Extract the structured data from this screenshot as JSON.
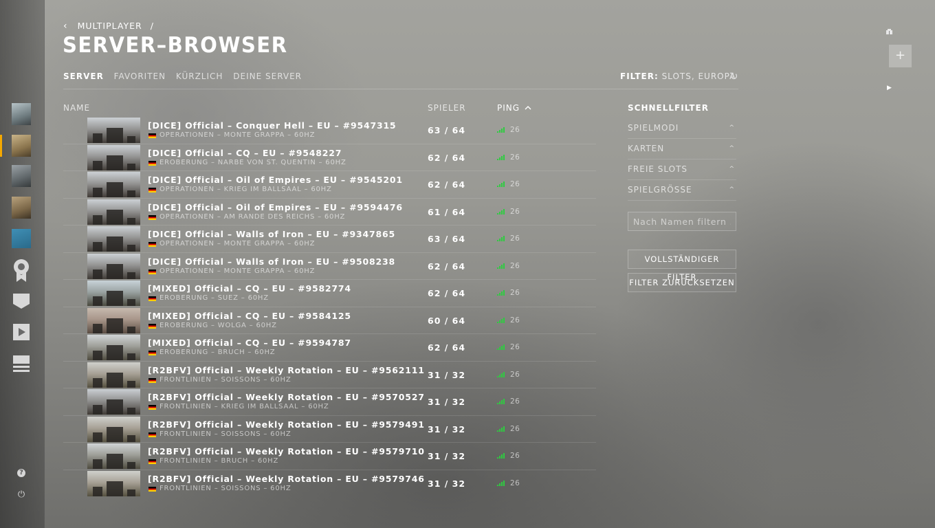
{
  "breadcrumb": {
    "back": "‹",
    "parent": "MULTIPLAYER",
    "sep": "/"
  },
  "page_title": "SERVER–BROWSER",
  "tabs": [
    "SERVER",
    "FAVORITEN",
    "KÜRZLICH",
    "DEINE SERVER"
  ],
  "filter_summary": {
    "label": "FILTER:",
    "value": " SLOTS, EUROPA"
  },
  "columns": {
    "name": "NAME",
    "players": "SPIELER",
    "ping": "PING"
  },
  "servers": [
    {
      "name": "[DICE] Official – Conquer Hell – EU – #9547315",
      "mode": "OPERATIONEN – MONTE GRAPPA – 60HZ",
      "players": "63 / 64",
      "ping": "26"
    },
    {
      "name": "[DICE] Official – CQ – EU – #9548227",
      "mode": "EROBERUNG – NARBE VON ST. QUENTIN – 60HZ",
      "players": "62 / 64",
      "ping": "26"
    },
    {
      "name": "[DICE] Official – Oil of Empires – EU – #9545201",
      "mode": "OPERATIONEN – KRIEG IM BALLSAAL – 60HZ",
      "players": "62 / 64",
      "ping": "26"
    },
    {
      "name": "[DICE] Official – Oil of Empires – EU – #9594476",
      "mode": "OPERATIONEN – AM RANDE DES REICHS – 60HZ",
      "players": "61 / 64",
      "ping": "26"
    },
    {
      "name": "[DICE] Official – Walls of Iron – EU – #9347865",
      "mode": "OPERATIONEN – MONTE GRAPPA – 60HZ",
      "players": "63 / 64",
      "ping": "26"
    },
    {
      "name": "[DICE] Official – Walls of Iron – EU – #9508238",
      "mode": "OPERATIONEN – MONTE GRAPPA – 60HZ",
      "players": "62 / 64",
      "ping": "26"
    },
    {
      "name": "[MIXED] Official – CQ – EU – #9582774",
      "mode": "EROBERUNG – SUEZ – 60HZ",
      "players": "62 / 64",
      "ping": "26"
    },
    {
      "name": "[MIXED] Official – CQ – EU – #9584125",
      "mode": "EROBERUNG – WOLGA – 60HZ",
      "players": "60 / 64",
      "ping": "26"
    },
    {
      "name": "[MIXED] Official – CQ – EU – #9594787",
      "mode": "EROBERUNG – BRUCH – 60HZ",
      "players": "62 / 64",
      "ping": "26"
    },
    {
      "name": "[R2BFV] Official – Weekly Rotation – EU – #9562111",
      "mode": "FRONTLINIEN – SOISSONS – 60HZ",
      "players": "31 / 32",
      "ping": "26"
    },
    {
      "name": "[R2BFV] Official – Weekly Rotation – EU – #9570527",
      "mode": "FRONTLINIEN – KRIEG IM BALLSAAL – 60HZ",
      "players": "31 / 32",
      "ping": "26"
    },
    {
      "name": "[R2BFV] Official – Weekly Rotation – EU – #9579491",
      "mode": "FRONTLINIEN – SOISSONS – 60HZ",
      "players": "31 / 32",
      "ping": "26"
    },
    {
      "name": "[R2BFV] Official – Weekly Rotation – EU – #9579710",
      "mode": "FRONTLINIEN – BRUCH – 60HZ",
      "players": "31 / 32",
      "ping": "26"
    },
    {
      "name": "[R2BFV] Official – Weekly Rotation – EU – #9579746",
      "mode": "FRONTLINIEN – SOISSONS – 60HZ",
      "players": "31 / 32",
      "ping": "26"
    }
  ],
  "quickfilter": {
    "title": "SCHNELLFILTER",
    "items": [
      "SPIELMODI",
      "KARTEN",
      "FREIE SLOTS",
      "SPIELGRÖSSE"
    ]
  },
  "name_filter": {
    "placeholder": "Nach Namen filtern ..."
  },
  "buttons": {
    "full_filter": "VOLLSTÄNDIGER FILTER",
    "reset_filter": "FILTER ZURÜCKSETZEN"
  },
  "add_button": "+",
  "colors": {
    "accent": "#f5a800",
    "ping_good": "#2ecc40",
    "flag_black": "#000000",
    "flag_red": "#dd0000",
    "flag_gold": "#ffce00"
  },
  "icons": [
    "back-chevron-icon",
    "refresh-icon",
    "sort-asc-icon",
    "ping-bars-icon",
    "flag-de-icon",
    "medal-icon",
    "chat-icon",
    "play-icon",
    "menu-icon",
    "help-icon",
    "power-icon",
    "party-icon",
    "chevron-up-icon"
  ]
}
